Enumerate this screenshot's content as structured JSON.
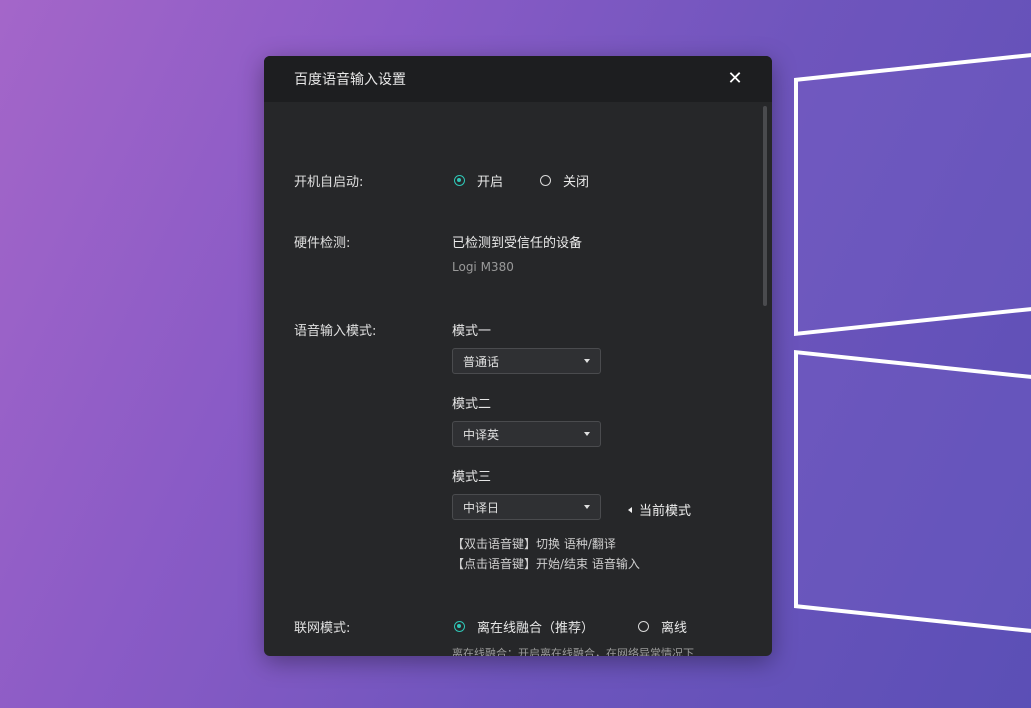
{
  "dialog": {
    "title": "百度语音输入设置",
    "close_symbol": "✕"
  },
  "startup": {
    "label": "开机自启动:",
    "options": [
      {
        "label": "开启",
        "checked": true
      },
      {
        "label": "关闭",
        "checked": false
      }
    ]
  },
  "hardware": {
    "label": "硬件检测:",
    "status": "已检测到受信任的设备",
    "device": "Logi M380"
  },
  "voice_mode": {
    "label": "语音输入模式:",
    "modes": [
      {
        "title": "模式一",
        "value": "普通话"
      },
      {
        "title": "模式二",
        "value": "中译英"
      },
      {
        "title": "模式三",
        "value": "中译日"
      }
    ],
    "current_label": "当前模式",
    "hints": [
      "【双击语音键】切换 语种/翻译",
      "【点击语音键】开始/结束 语音输入"
    ]
  },
  "network": {
    "label": "联网模式:",
    "options": [
      {
        "label": "离在线融合（推荐）",
        "checked": true
      },
      {
        "label": "离线",
        "checked": false
      }
    ],
    "description": "离在线融合：开启离在线融合，在网络异常情况下会自动进行离线语音识别，确保语音识别正常使用"
  },
  "colors": {
    "accent": "#2fc6b6",
    "dialog_bg": "#262729",
    "titlebar_bg": "#1d1e20"
  }
}
